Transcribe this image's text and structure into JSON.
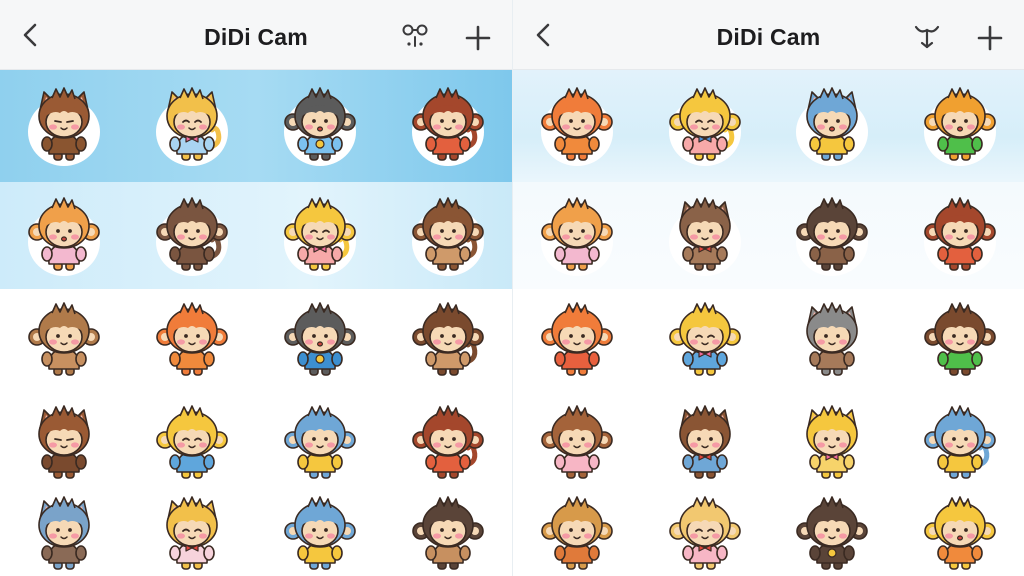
{
  "colors": {
    "outline": "#3a2a22",
    "skin": "#f6d9b6",
    "cheek": "#f59aa5"
  },
  "panels": [
    {
      "title": "DiDi Cam",
      "back_icon": "chevron-left-icon",
      "mode_icon": "face-filter-icon",
      "add_icon": "plus-icon",
      "stickers": [
        {
          "hair": "#9a5a34",
          "ears": "cat",
          "face": "wink",
          "shirt": "#8a5530",
          "bow": "none",
          "tail": false
        },
        {
          "hair": "#f2c04a",
          "ears": "cat",
          "face": "happy",
          "shirt": "#a9d4f2",
          "bow": "pink",
          "tail": true
        },
        {
          "hair": "#5b5b5b",
          "ears": "monkey",
          "face": "open",
          "shirt": "#7cc1ee",
          "bow": "sun",
          "tail": false
        },
        {
          "hair": "#a4472c",
          "ears": "monkey",
          "face": "smile",
          "shirt": "#e3603e",
          "bow": "none",
          "tail": true
        },
        {
          "hair": "#f0a04a",
          "ears": "monkey",
          "face": "open",
          "shirt": "#f3b8cf",
          "bow": "none",
          "tail": false
        },
        {
          "hair": "#7a5540",
          "ears": "monkey",
          "face": "smile",
          "shirt": "#7a5540",
          "bow": "none",
          "tail": true
        },
        {
          "hair": "#f5c73e",
          "ears": "monkey",
          "face": "happy",
          "shirt": "#f7a9a9",
          "bow": "pink",
          "tail": true
        },
        {
          "hair": "#8a5534",
          "ears": "monkey",
          "face": "smile",
          "shirt": "#cf9a6a",
          "bow": "none",
          "tail": true
        },
        {
          "hair": "#b07a4a",
          "ears": "monkey",
          "face": "smile",
          "shirt": "#c79060",
          "bow": "none",
          "tail": false
        },
        {
          "hair": "#f07c3a",
          "ears": "monkey",
          "face": "smile",
          "shirt": "#f08a3c",
          "bow": "none",
          "tail": false
        },
        {
          "hair": "#5c5c5c",
          "ears": "monkey",
          "face": "open",
          "shirt": "#3d8fd0",
          "bow": "sun",
          "tail": false
        },
        {
          "hair": "#7a4a2e",
          "ears": "monkey",
          "face": "smile",
          "shirt": "#cf9a6a",
          "bow": "none",
          "tail": true
        },
        {
          "hair": "#9a5a34",
          "ears": "cat",
          "face": "wink",
          "shirt": "#7a4a2e",
          "bow": "none",
          "tail": false
        },
        {
          "hair": "#f5c73e",
          "ears": "monkey",
          "face": "happy",
          "shirt": "#5fa6dc",
          "bow": "none",
          "tail": false
        },
        {
          "hair": "#6fa7d6",
          "ears": "monkey",
          "face": "smile",
          "shirt": "#f5c73e",
          "bow": "none",
          "tail": false
        },
        {
          "hair": "#a4472c",
          "ears": "monkey",
          "face": "smile",
          "shirt": "#e3603e",
          "bow": "none",
          "tail": true
        },
        {
          "hair": "#7aa3c9",
          "ears": "cat",
          "face": "smile",
          "shirt": "#8a6a56",
          "bow": "none",
          "tail": false
        },
        {
          "hair": "#f2c04a",
          "ears": "cat",
          "face": "happy",
          "shirt": "#f7d3dc",
          "bow": "red",
          "tail": false
        },
        {
          "hair": "#6fa7d6",
          "ears": "monkey",
          "face": "smile",
          "shirt": "#f5c73e",
          "bow": "none",
          "tail": false
        },
        {
          "hair": "#5a4438",
          "ears": "monkey",
          "face": "smile",
          "shirt": "#c79060",
          "bow": "none",
          "tail": false
        }
      ]
    },
    {
      "title": "DiDi Cam",
      "back_icon": "chevron-left-icon",
      "mode_icon": "beauty-filter-icon",
      "add_icon": "plus-icon",
      "stickers": [
        {
          "hair": "#f07c3a",
          "ears": "monkey",
          "face": "smile",
          "shirt": "#f08a3c",
          "bow": "none",
          "tail": false
        },
        {
          "hair": "#f5c73e",
          "ears": "monkey",
          "face": "happy",
          "shirt": "#f7a9a9",
          "bow": "blue",
          "tail": true
        },
        {
          "hair": "#6fa7d6",
          "ears": "cat",
          "face": "open",
          "shirt": "#f5c73e",
          "bow": "none",
          "tail": false
        },
        {
          "hair": "#f0a030",
          "ears": "monkey",
          "face": "open",
          "shirt": "#4fbf4a",
          "bow": "none",
          "tail": false
        },
        {
          "hair": "#f0a04a",
          "ears": "monkey",
          "face": "smile",
          "shirt": "#f3b8cf",
          "bow": "none",
          "tail": false
        },
        {
          "hair": "#8a6248",
          "ears": "cat",
          "face": "smile",
          "shirt": "#a67a5a",
          "bow": "red",
          "tail": false
        },
        {
          "hair": "#5a4438",
          "ears": "monkey",
          "face": "smile",
          "shirt": "#8a6248",
          "bow": "none",
          "tail": false
        },
        {
          "hair": "#a4472c",
          "ears": "monkey",
          "face": "smile",
          "shirt": "#e3603e",
          "bow": "none",
          "tail": false
        },
        {
          "hair": "#f07c3a",
          "ears": "monkey",
          "face": "smile",
          "shirt": "#e8603e",
          "bow": "none",
          "tail": false
        },
        {
          "hair": "#f5c73e",
          "ears": "monkey",
          "face": "happy",
          "shirt": "#5fa6dc",
          "bow": "pink",
          "tail": false
        },
        {
          "hair": "#8a8a8a",
          "ears": "cat",
          "face": "smile",
          "shirt": "#a67a5a",
          "bow": "none",
          "tail": false
        },
        {
          "hair": "#7a4a2e",
          "ears": "monkey",
          "face": "smile",
          "shirt": "#4fbf4a",
          "bow": "none",
          "tail": false
        },
        {
          "hair": "#a4633a",
          "ears": "monkey",
          "face": "smile",
          "shirt": "#f7b6c5",
          "bow": "none",
          "tail": false
        },
        {
          "hair": "#8a5534",
          "ears": "cat",
          "face": "smile",
          "shirt": "#6fa7d6",
          "bow": "red",
          "tail": false
        },
        {
          "hair": "#f5c73e",
          "ears": "cat",
          "face": "smile",
          "shirt": "#f7d36a",
          "bow": "pink",
          "tail": false
        },
        {
          "hair": "#6fa7d6",
          "ears": "monkey",
          "face": "smile",
          "shirt": "#f5c73e",
          "bow": "none",
          "tail": true
        },
        {
          "hair": "#d79a4a",
          "ears": "monkey",
          "face": "smile",
          "shirt": "#e07a3a",
          "bow": "none",
          "tail": false
        },
        {
          "hair": "#f2c870",
          "ears": "monkey",
          "face": "happy",
          "shirt": "#f7b6c5",
          "bow": "red",
          "tail": false
        },
        {
          "hair": "#5a4438",
          "ears": "monkey",
          "face": "smile",
          "shirt": "#5a4438",
          "bow": "sun",
          "tail": false
        },
        {
          "hair": "#f5c73e",
          "ears": "monkey",
          "face": "open",
          "shirt": "#f08a3c",
          "bow": "none",
          "tail": false
        }
      ]
    }
  ]
}
